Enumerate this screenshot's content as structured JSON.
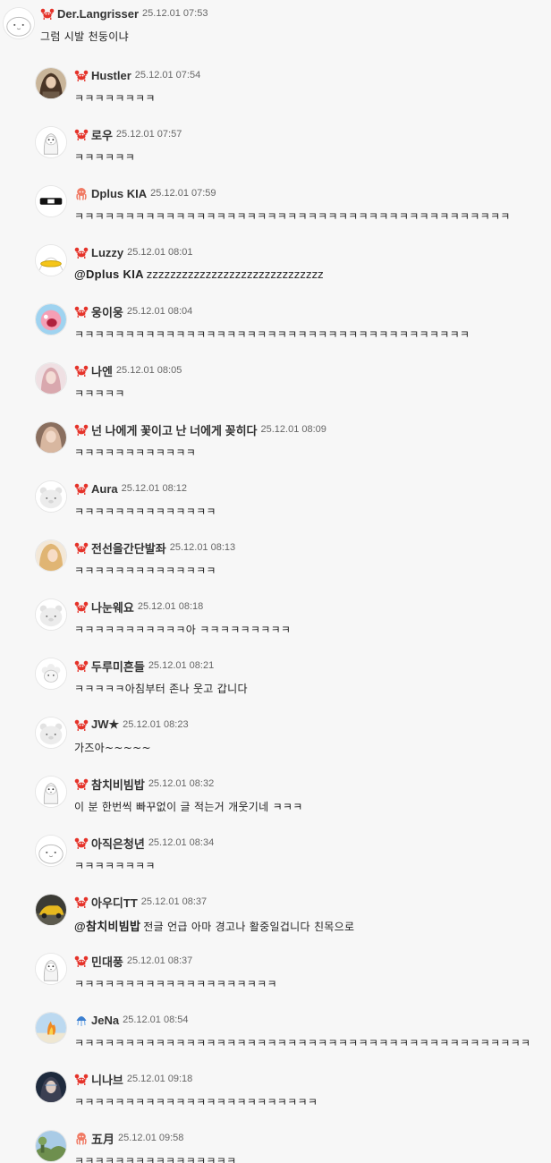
{
  "comments": [
    {
      "nick": "Der.Langrisser",
      "time": "25.12.01 07:53",
      "mention": "",
      "text": "그럼 시발 천둥이냐",
      "level": "crab-icon",
      "avatar": "blank-face",
      "depth": 0
    },
    {
      "nick": "Hustler",
      "time": "25.12.01 07:54",
      "mention": "",
      "text": "ㅋㅋㅋㅋㅋㅋㅋㅋ",
      "level": "crab-icon",
      "avatar": "photo-person-dark",
      "depth": 1
    },
    {
      "nick": "로우",
      "time": "25.12.01 07:57",
      "mention": "",
      "text": "ㅋㅋㅋㅋㅋㅋ",
      "level": "crab-icon",
      "avatar": "penguin",
      "depth": 1
    },
    {
      "nick": "Dplus KIA",
      "time": "25.12.01 07:59",
      "mention": "",
      "text": "ㅋㅋㅋㅋㅋㅋㅋㅋㅋㅋㅋㅋㅋㅋㅋㅋㅋㅋㅋㅋㅋㅋㅋㅋㅋㅋㅋㅋㅋㅋㅋㅋㅋㅋㅋㅋㅋㅋㅋㅋㅋㅋㅋ",
      "level": "octopus-icon",
      "avatar": "team-logo",
      "depth": 1
    },
    {
      "nick": "Luzzy",
      "time": "25.12.01 08:01",
      "mention": "@Dplus KIA",
      "text": "zzzzzzzzzzzzzzzzzzzzzzzzzzzzzz",
      "level": "crab-icon",
      "avatar": "yellow-beak",
      "depth": 1
    },
    {
      "nick": "웅이웅",
      "time": "25.12.01 08:04",
      "mention": "",
      "text": "ㅋㅋㅋㅋㅋㅋㅋㅋㅋㅋㅋㅋㅋㅋㅋㅋㅋㅋㅋㅋㅋㅋㅋㅋㅋㅋㅋㅋㅋㅋㅋㅋㅋㅋㅋㅋㅋㅋㅋ",
      "level": "crab-icon",
      "avatar": "pink-character",
      "depth": 1
    },
    {
      "nick": "나엔",
      "time": "25.12.01 08:05",
      "mention": "",
      "text": "ㅋㅋㅋㅋㅋ",
      "level": "crab-icon",
      "avatar": "photo-person-light",
      "depth": 1
    },
    {
      "nick": "넌 나에게 꽃이고 난 너에게 꽂히다",
      "time": "25.12.01 08:09",
      "mention": "",
      "text": "ㅋㅋㅋㅋㅋㅋㅋㅋㅋㅋㅋㅋ",
      "level": "crab-icon",
      "avatar": "photo-person-warm",
      "depth": 1
    },
    {
      "nick": "Aura",
      "time": "25.12.01 08:12",
      "mention": "",
      "text": "ㅋㅋㅋㅋㅋㅋㅋㅋㅋㅋㅋㅋㅋㅋ",
      "level": "crab-icon",
      "avatar": "bear-face",
      "depth": 1
    },
    {
      "nick": "전선을간단발좌",
      "time": "25.12.01 08:13",
      "mention": "",
      "text": "ㅋㅋㅋㅋㅋㅋㅋㅋㅋㅋㅋㅋㅋㅋ",
      "level": "crab-icon",
      "avatar": "photo-person-blond",
      "depth": 1
    },
    {
      "nick": "나눈웨요",
      "time": "25.12.01 08:18",
      "mention": "",
      "text": "ㅋㅋㅋㅋㅋㅋㅋㅋㅋㅋㅋ아 ㅋㅋㅋㅋㅋㅋㅋㅋㅋ",
      "level": "crab-icon",
      "avatar": "bear-face",
      "depth": 1
    },
    {
      "nick": "두루미흔들",
      "time": "25.12.01 08:21",
      "mention": "",
      "text": "ㅋㅋㅋㅋㅋ아침부터 존나 웃고 갑니다",
      "level": "crab-icon",
      "avatar": "sheep-face",
      "depth": 1
    },
    {
      "nick": "JW★",
      "time": "25.12.01 08:23",
      "mention": "",
      "text": "가즈아~~~~~",
      "level": "crab-icon",
      "avatar": "bear-face",
      "depth": 1
    },
    {
      "nick": "참치비빔밥",
      "time": "25.12.01 08:32",
      "mention": "",
      "text": "이 분 한번씩 빠꾸없이 글 적는거 개웃기네 ㅋㅋㅋ",
      "level": "crab-icon",
      "avatar": "penguin",
      "depth": 1
    },
    {
      "nick": "아직은청년",
      "time": "25.12.01 08:34",
      "mention": "",
      "text": "ㅋㅋㅋㅋㅋㅋㅋㅋ",
      "level": "crab-icon",
      "avatar": "blank-face",
      "depth": 1
    },
    {
      "nick": "아우디TT",
      "time": "25.12.01 08:37",
      "mention": "@참치비빔밥",
      "text": "전글 언급 아마 경고나 활중일겁니다 친목으로",
      "level": "crab-icon",
      "avatar": "photo-car",
      "depth": 1
    },
    {
      "nick": "민대풍",
      "time": "25.12.01 08:37",
      "mention": "",
      "text": "ㅋㅋㅋㅋㅋㅋㅋㅋㅋㅋㅋㅋㅋㅋㅋㅋㅋㅋㅋㅋ",
      "level": "crab-icon",
      "avatar": "penguin",
      "depth": 1
    },
    {
      "nick": "JeNa",
      "time": "25.12.01 08:54",
      "mention": "",
      "text": "ㅋㅋㅋㅋㅋㅋㅋㅋㅋㅋㅋㅋㅋㅋㅋㅋㅋㅋㅋㅋㅋㅋㅋㅋㅋㅋㅋㅋㅋㅋㅋㅋㅋㅋㅋㅋㅋㅋㅋㅋㅋㅋㅋㅋㅋ",
      "level": "jellyfish-icon",
      "avatar": "photo-fire",
      "depth": 1
    },
    {
      "nick": "니나브",
      "time": "25.12.01 09:18",
      "mention": "",
      "text": "ㅋㅋㅋㅋㅋㅋㅋㅋㅋㅋㅋㅋㅋㅋㅋㅋㅋㅋㅋㅋㅋㅋㅋㅋ",
      "level": "crab-icon",
      "avatar": "photo-person-blue",
      "depth": 1
    },
    {
      "nick": "五月",
      "time": "25.12.01 09:58",
      "mention": "",
      "text": "ㅋㅋㅋㅋㅋㅋㅋㅋㅋㅋㅋㅋㅋㅋㅋㅋ",
      "level": "octopus-icon",
      "avatar": "photo-landscape",
      "depth": 1
    }
  ]
}
